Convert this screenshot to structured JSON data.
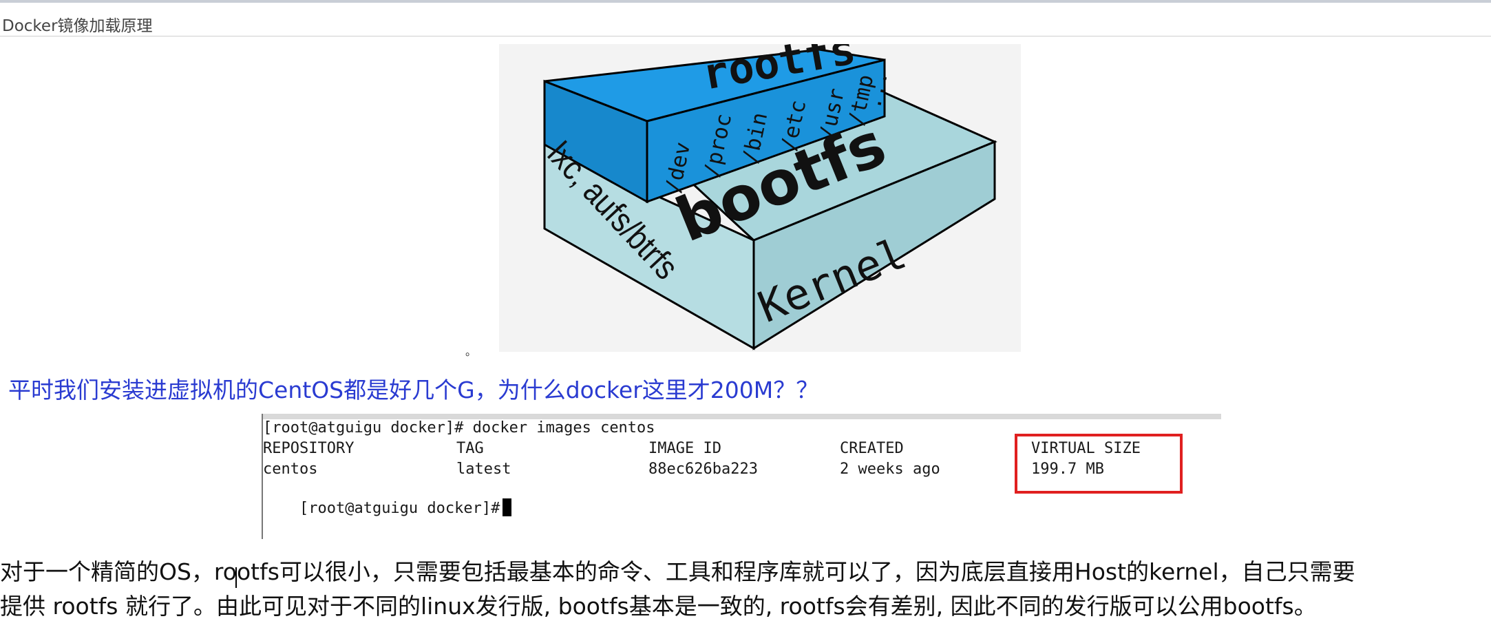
{
  "document": {
    "title": "Docker镜像加载原理"
  },
  "diagram": {
    "top_label": "rootfs",
    "top_dirs": [
      "/dev",
      "/proc",
      "/bin",
      "/etc",
      "/usr",
      "/tmp",
      "..."
    ],
    "middle_label": "bootfs",
    "middle_side": "lxc, aufs/btrfs",
    "bottom_label": "Kernel",
    "colors": {
      "rootfs": "#1b9ae0",
      "bootfs": "#9fd0d8",
      "kernel": "#a6d3da"
    }
  },
  "caption_dot": "。",
  "question": "平时我们安装进虚拟机的CentOS都是好几个G，为什么docker这里才200M？？",
  "terminal": {
    "line1": "[root@atguigu docker]# docker images centos",
    "headers": [
      "REPOSITORY",
      "TAG",
      "IMAGE ID",
      "CREATED",
      "VIRTUAL SIZE"
    ],
    "row": [
      "centos",
      "latest",
      "88ec626ba223",
      "2 weeks ago",
      "199.7 MB"
    ],
    "prompt": "[root@atguigu docker]#"
  },
  "paragraph": {
    "line1": "对于一个精简的OS，rootfs可以很小，只需要包括最基本的命令、工具和程序库就可以了，因为底层直接用Host的kernel，自己只需要",
    "line2": "提供 rootfs 就行了。由此可见对于不同的linux发行版, bootfs基本是一致的, rootfs会有差别, 因此不同的发行版可以公用bootfs。"
  }
}
